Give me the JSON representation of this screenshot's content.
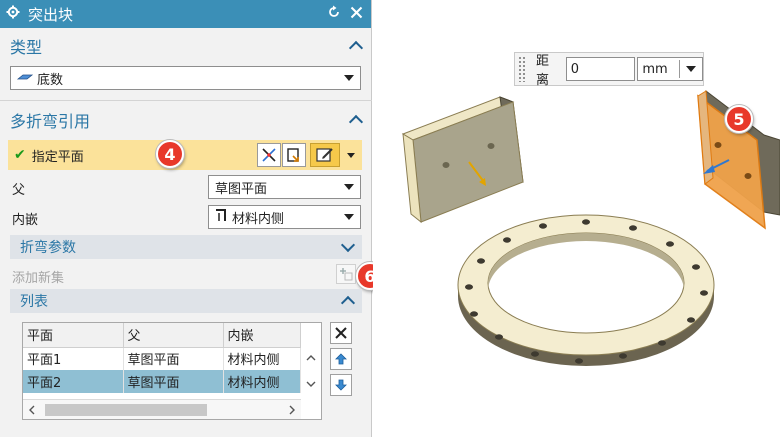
{
  "window": {
    "title": "突出块",
    "icons": {
      "gear": "gear-icon",
      "reset": "reset-icon",
      "close": "close-icon"
    }
  },
  "type_section": {
    "title": "类型",
    "selected": "底数"
  },
  "bend_section": {
    "title": "多折弯引用",
    "select_plane_label": "指定平面",
    "badges": {
      "select": "4",
      "add": "6",
      "viewport": "5"
    },
    "parent_label": "父",
    "parent_value": "草图平面",
    "inset_label": "内嵌",
    "inset_value": "材料内侧",
    "params_label": "折弯参数",
    "add_set_label": "添加新集"
  },
  "list_section": {
    "title": "列表",
    "columns": [
      "平面",
      "父",
      "内嵌"
    ],
    "rows": [
      [
        "平面1",
        "草图平面",
        "材料内侧"
      ],
      [
        "平面2",
        "草图平面",
        "材料内侧"
      ]
    ],
    "selected_row": 1
  },
  "viewport": {
    "distance_label": "距离",
    "distance_value": "0",
    "unit": "mm"
  },
  "colors": {
    "title_bar": "#3b8fb7",
    "section_title": "#2b77a6",
    "highlight_row": "#fbe29a",
    "selected_row": "#8fbfd3",
    "badge": "#e8382a",
    "plate_highlight": "#f09a3c"
  }
}
